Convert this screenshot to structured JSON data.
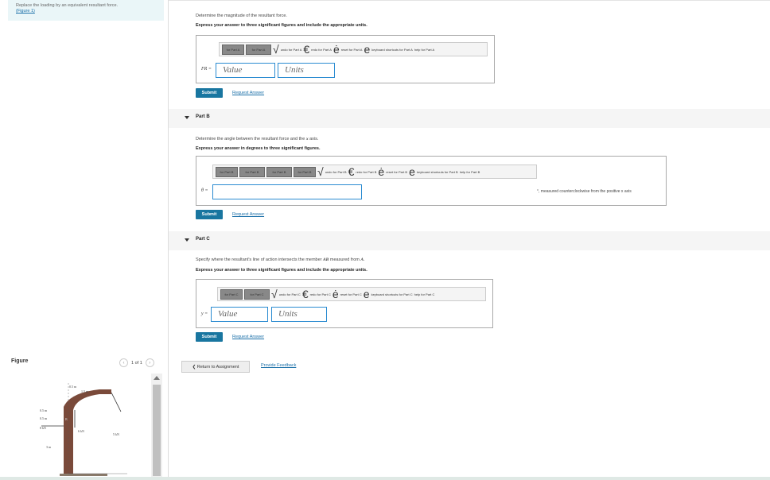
{
  "sidebar": {
    "intro_text": "Replace the loading by an equivalent resultant force.",
    "figure_link": "(Figure 1)",
    "figure_heading": "Figure",
    "pager": "1 of 1",
    "figure_labels": {
      "dim_top": "0.5 m",
      "dim_top2": "1.5 m",
      "dim_left1": "0.5 m",
      "dim_left2": "0.5 m",
      "force_left": "8 kN",
      "force_mid": "6 kN",
      "force_right": "5 kN",
      "dim_h": "3 m",
      "point_b": "B"
    }
  },
  "partA": {
    "instruction": "Determine the magnitude of the resultant force.",
    "express": "Express your answer to three significant figures and include the appropriate units.",
    "toolbar": {
      "btn1": "for Part A",
      "btn2": "for Part A",
      "undo": "undo for Part A",
      "redo": "redo for Part A",
      "reset": "reset for Part A",
      "shortcuts": "keyboard shortcuts for Part A",
      "help": "help for Part A"
    },
    "label": "FR =",
    "value_placeholder": "Value",
    "units_placeholder": "Units",
    "submit": "Submit",
    "request": "Request Answer"
  },
  "partB": {
    "heading": "Part B",
    "instruction_pre": "Determine the angle between the resultant force and the ",
    "instruction_var": "x",
    "instruction_post": " axis.",
    "express": "Express your answer in degrees to three significant figures.",
    "toolbar": {
      "btn1": "for Part B",
      "btn2": "for Part B",
      "btn3": "for Part B",
      "btn4": "for Part B",
      "undo": "undo for Part B",
      "redo": "redo for Part B",
      "reset": "reset for Part B",
      "shortcuts": "keyboard shortcuts for Part B",
      "help": "help for Part B"
    },
    "label": "θ =",
    "suffix": "°, measured counterclockwise from the positive x axis",
    "submit": "Submit",
    "request": "Request Answer"
  },
  "partC": {
    "heading": "Part C",
    "instruction_pre": "Specify where the resultant's line of action intersects the member ",
    "instruction_var1": "AB",
    "instruction_mid": " measured from ",
    "instruction_var2": "A",
    "instruction_post": ".",
    "express": "Express your answer to three significant figures and include the appropriate units.",
    "toolbar": {
      "btn1": "for Part C",
      "btn2": "for Part C",
      "undo": "undo for Part C",
      "redo": "redo for Part C",
      "reset": "reset for Part C",
      "shortcuts": "keyboard shortcuts for Part C",
      "help": "help for Part C"
    },
    "label": "y =",
    "value_placeholder": "Value",
    "units_placeholder": "Units",
    "submit": "Submit",
    "request": "Request Answer"
  },
  "footer": {
    "return": "❮ Return to Assignment",
    "feedback": "Provide Feedback"
  },
  "colors": {
    "accent": "#1976a0",
    "link": "#1a6fa8",
    "field_border": "#2a8bd1",
    "intro_bg": "#eaf6f8"
  }
}
